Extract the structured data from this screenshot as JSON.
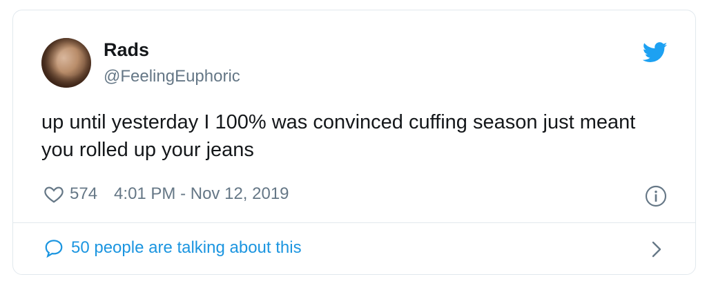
{
  "tweet": {
    "author_name": "Rads",
    "author_handle": "@FeelingEuphoric",
    "text": "up until yesterday I 100% was convinced cuffing season just meant you rolled up your jeans",
    "like_count": "574",
    "timestamp": "4:01 PM - Nov 12, 2019",
    "conversation_link": "50 people are talking about this"
  },
  "icons": {
    "logo": "twitter-bird-icon",
    "like": "heart-icon",
    "info": "info-icon",
    "reply": "speech-bubble-icon",
    "chevron": "chevron-right-icon"
  },
  "colors": {
    "brand": "#1da1f2",
    "link": "#1b95e0",
    "secondary_text": "#657786",
    "border": "#e1e8ed"
  }
}
